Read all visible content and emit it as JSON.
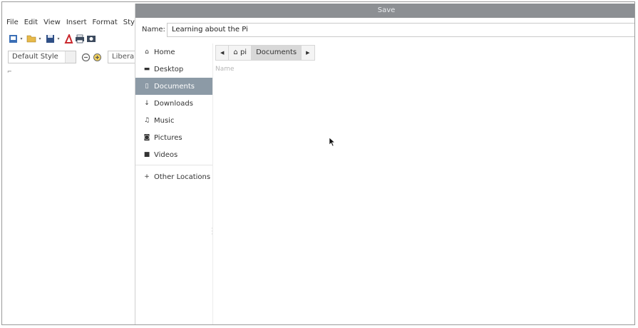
{
  "app": {
    "menu": [
      "File",
      "Edit",
      "View",
      "Insert",
      "Format",
      "Styl"
    ],
    "toolbar_icons": [
      "new-doc-icon",
      "open-folder-icon",
      "save-icon",
      "export-pdf-icon",
      "print-icon",
      "print-preview-icon"
    ],
    "paragraph_style": "Default Style",
    "font_name": "Libera"
  },
  "dialog": {
    "title": "Save",
    "name_label": "Name:",
    "name_value": "Learning about the Pi",
    "places": [
      {
        "icon": "home-icon",
        "label": "Home",
        "selected": false
      },
      {
        "icon": "folder-icon",
        "label": "Desktop",
        "selected": false
      },
      {
        "icon": "document-icon",
        "label": "Documents",
        "selected": true
      },
      {
        "icon": "download-icon",
        "label": "Downloads",
        "selected": false
      },
      {
        "icon": "music-icon",
        "label": "Music",
        "selected": false
      },
      {
        "icon": "camera-icon",
        "label": "Pictures",
        "selected": false
      },
      {
        "icon": "video-icon",
        "label": "Videos",
        "selected": false
      }
    ],
    "other_locations": "Other Locations",
    "path": {
      "back": "◀",
      "crumbs": [
        "pi",
        "Documents"
      ],
      "forward": "▶"
    },
    "column_name": "Name"
  }
}
